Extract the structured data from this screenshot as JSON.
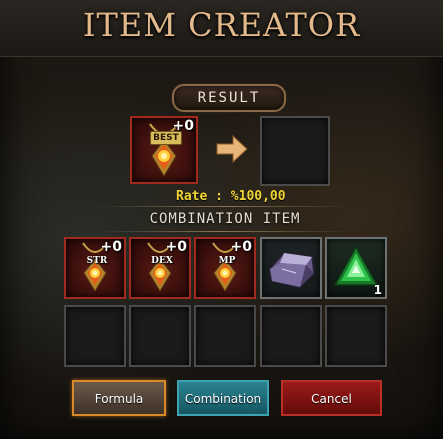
{
  "window": {
    "title": "ITEM CREATOR"
  },
  "result": {
    "label": "RESULT",
    "source_item": {
      "badge": "BEST",
      "enhance": "+0",
      "icon": "amulet-icon"
    },
    "target_item": null
  },
  "rate_text": "Rate : %100,00",
  "combination": {
    "label": "COMBINATION ITEM",
    "row1": [
      {
        "tag": "STR",
        "enhance": "+0",
        "icon": "amulet-icon"
      },
      {
        "tag": "DEX",
        "enhance": "+0",
        "icon": "amulet-icon"
      },
      {
        "tag": "MP",
        "enhance": "+0",
        "icon": "amulet-icon"
      },
      {
        "icon": "silver-ore-icon"
      },
      {
        "icon": "green-gem-icon",
        "count": "1"
      }
    ],
    "row2_empty_slots": 5
  },
  "buttons": {
    "formula": "Formula",
    "combination": "Combination",
    "cancel": "Cancel"
  },
  "colors": {
    "title": "#e3b98b",
    "rate": "#f0d334",
    "formula_border": "#d88a2a",
    "combination_bg": "#1f6f7c",
    "cancel_bg": "#8a1512"
  }
}
